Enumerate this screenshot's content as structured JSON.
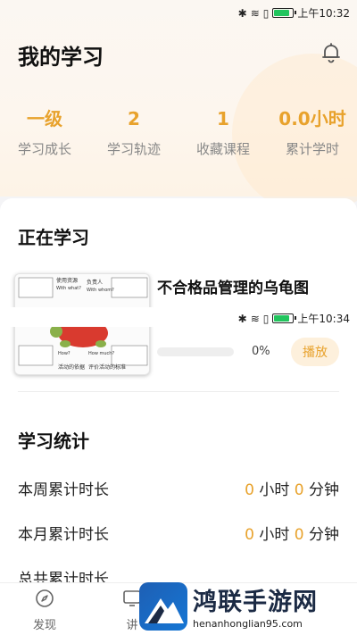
{
  "status_bar": {
    "time": "上午10:32"
  },
  "header": {
    "title": "我的学习",
    "stats": [
      {
        "value": "一级",
        "label": "学习成长"
      },
      {
        "value": "2",
        "label": "学习轨迹"
      },
      {
        "value": "1",
        "label": "收藏课程"
      },
      {
        "value": "0.0小时",
        "label": "累计学时"
      }
    ]
  },
  "learning": {
    "section_title": "正在学习",
    "course": {
      "name": "不合格品管理的乌龟图",
      "progress": 0,
      "progress_label": "0%",
      "play_label": "播放",
      "thumb_texts": {
        "top_left": "使用资源",
        "top_left_en": "With what?",
        "top_right": "负责人",
        "top_right_en": "With whom?",
        "bottom_left_en": "How?",
        "bottom_right_en": "How much?",
        "bottom_left": "活动的依据",
        "bottom_right": "评价活动的标准"
      }
    },
    "overlay_status_time": "上午10:34"
  },
  "stats_section": {
    "title": "学习统计",
    "rows": [
      {
        "label": "本周累计时长",
        "hours": "0",
        "hour_unit": "小时",
        "minutes": "0",
        "minute_unit": "分钟"
      },
      {
        "label": "本月累计时长",
        "hours": "0",
        "hour_unit": "小时",
        "minutes": "0",
        "minute_unit": "分钟"
      },
      {
        "label": "总共累计时长"
      }
    ]
  },
  "tabbar": {
    "tabs": [
      {
        "label": "发现"
      },
      {
        "label": "讲"
      }
    ]
  },
  "watermark": {
    "title": "鸿联手游网",
    "url": "henanhonglian95.com"
  },
  "colors": {
    "accent": "#e8a22c",
    "accent_bg": "#fdf0dc"
  }
}
